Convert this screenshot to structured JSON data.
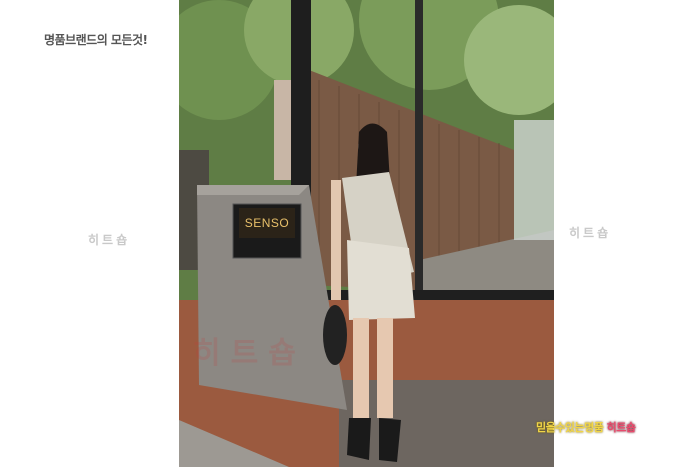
{
  "page": {
    "tagline": "명품브랜드의 모든것!",
    "side_watermark_left": "히트숍",
    "side_watermark_right": "히트숍"
  },
  "photo": {
    "sign_text": "SENSO",
    "overlay_watermark": "히트숍",
    "badge_part1": "믿을수있는명품 ",
    "badge_part2": "히트숍"
  },
  "colors": {
    "badge_yellow": "#f1d548",
    "badge_pink": "#e94a6c",
    "sign_gold": "#e8c06a"
  }
}
